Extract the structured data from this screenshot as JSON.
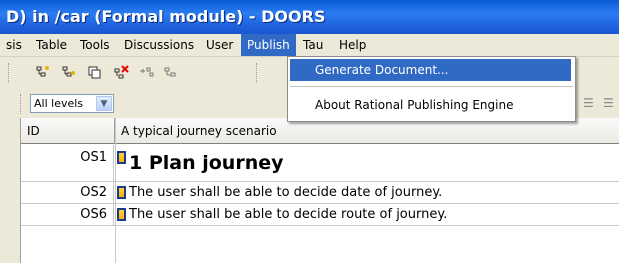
{
  "window": {
    "title": "D) in /car (Formal module) - DOORS"
  },
  "menubar": {
    "items": [
      {
        "label": "sis",
        "active": false
      },
      {
        "label": "Table",
        "active": false
      },
      {
        "label": "Tools",
        "active": false
      },
      {
        "label": "Discussions",
        "active": false
      },
      {
        "label": "User",
        "active": false
      },
      {
        "label": "Publish",
        "active": true
      },
      {
        "label": "Tau",
        "active": false
      },
      {
        "label": "Help",
        "active": false
      }
    ]
  },
  "publish_menu": {
    "items": [
      {
        "label": "Generate Document...",
        "highlighted": true
      },
      {
        "label": "About Rational Publishing Engine",
        "highlighted": false
      }
    ]
  },
  "toolbar": {
    "icons": [
      "insert-object-icon",
      "insert-below-icon",
      "copy-object-icon",
      "delete-object-icon",
      "link-icon",
      "indent-icon"
    ]
  },
  "levels": {
    "selected": "All levels"
  },
  "table": {
    "columns": [
      "ID",
      "A typical journey scenario"
    ],
    "rows": [
      {
        "id": "OS1",
        "text": "1 Plan journey",
        "heading": true
      },
      {
        "id": "OS2",
        "text": "The user shall be able to decide date of journey.",
        "heading": false
      },
      {
        "id": "OS6",
        "text": "The user shall be able to decide route of journey.",
        "heading": false
      }
    ]
  },
  "colors": {
    "title_bar": "#1f63e0",
    "menu_highlight": "#316ac5",
    "window_bg": "#ece9d8"
  }
}
